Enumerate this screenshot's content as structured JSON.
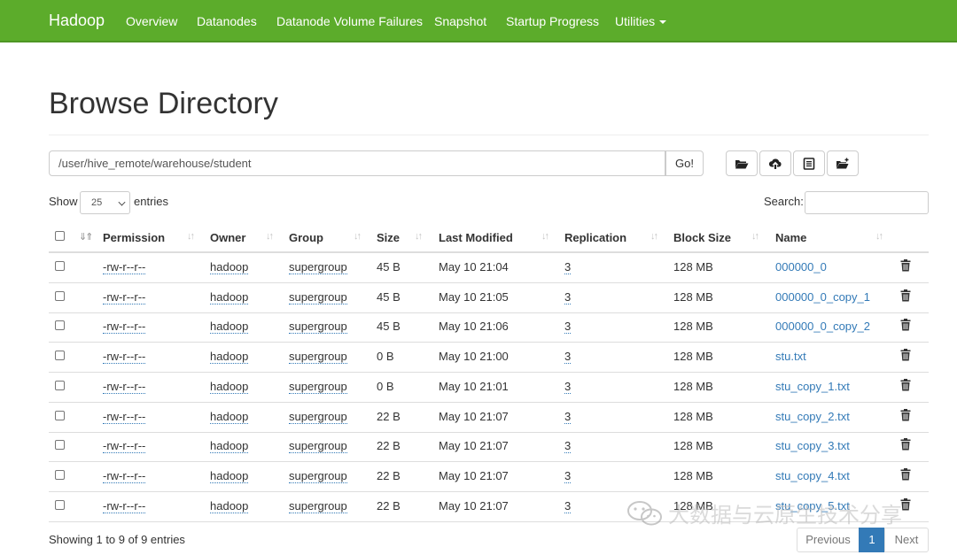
{
  "navbar": {
    "brand": "Hadoop",
    "links": [
      "Overview",
      "Datanodes",
      "Datanode Volume Failures",
      "Snapshot",
      "Startup Progress",
      "Utilities"
    ]
  },
  "page_title": "Browse Directory",
  "path_bar": {
    "value": "/user/hive_remote/warehouse/student",
    "go_label": "Go!"
  },
  "toolbar_icons": [
    "folder-open-icon",
    "cloud-upload-icon",
    "list-alt-icon",
    "folder-plus-icon"
  ],
  "length_menu": {
    "prefix": "Show",
    "value": "25",
    "suffix": "entries"
  },
  "search": {
    "label": "Search:",
    "value": ""
  },
  "table": {
    "columns": [
      "Permission",
      "Owner",
      "Group",
      "Size",
      "Last Modified",
      "Replication",
      "Block Size",
      "Name"
    ],
    "rows": [
      {
        "permission": "-rw-r--r--",
        "owner": "hadoop",
        "group": "supergroup",
        "size": "45 B",
        "modified": "May 10 21:04",
        "replication": "3",
        "block_size": "128 MB",
        "name": "000000_0"
      },
      {
        "permission": "-rw-r--r--",
        "owner": "hadoop",
        "group": "supergroup",
        "size": "45 B",
        "modified": "May 10 21:05",
        "replication": "3",
        "block_size": "128 MB",
        "name": "000000_0_copy_1"
      },
      {
        "permission": "-rw-r--r--",
        "owner": "hadoop",
        "group": "supergroup",
        "size": "45 B",
        "modified": "May 10 21:06",
        "replication": "3",
        "block_size": "128 MB",
        "name": "000000_0_copy_2"
      },
      {
        "permission": "-rw-r--r--",
        "owner": "hadoop",
        "group": "supergroup",
        "size": "0 B",
        "modified": "May 10 21:00",
        "replication": "3",
        "block_size": "128 MB",
        "name": "stu.txt"
      },
      {
        "permission": "-rw-r--r--",
        "owner": "hadoop",
        "group": "supergroup",
        "size": "0 B",
        "modified": "May 10 21:01",
        "replication": "3",
        "block_size": "128 MB",
        "name": "stu_copy_1.txt"
      },
      {
        "permission": "-rw-r--r--",
        "owner": "hadoop",
        "group": "supergroup",
        "size": "22 B",
        "modified": "May 10 21:07",
        "replication": "3",
        "block_size": "128 MB",
        "name": "stu_copy_2.txt"
      },
      {
        "permission": "-rw-r--r--",
        "owner": "hadoop",
        "group": "supergroup",
        "size": "22 B",
        "modified": "May 10 21:07",
        "replication": "3",
        "block_size": "128 MB",
        "name": "stu_copy_3.txt"
      },
      {
        "permission": "-rw-r--r--",
        "owner": "hadoop",
        "group": "supergroup",
        "size": "22 B",
        "modified": "May 10 21:07",
        "replication": "3",
        "block_size": "128 MB",
        "name": "stu_copy_4.txt"
      },
      {
        "permission": "-rw-r--r--",
        "owner": "hadoop",
        "group": "supergroup",
        "size": "22 B",
        "modified": "May 10 21:07",
        "replication": "3",
        "block_size": "128 MB",
        "name": "stu_copy_5.txt"
      }
    ]
  },
  "footer": {
    "info": "Showing 1 to 9 of 9 entries",
    "prev": "Previous",
    "page": "1",
    "next": "Next"
  },
  "watermark": {
    "text": "大数据与云原生技术分享"
  },
  "colors": {
    "navbar": "#5cac2b",
    "link": "#337ab7",
    "active_page": "#337ab7"
  }
}
